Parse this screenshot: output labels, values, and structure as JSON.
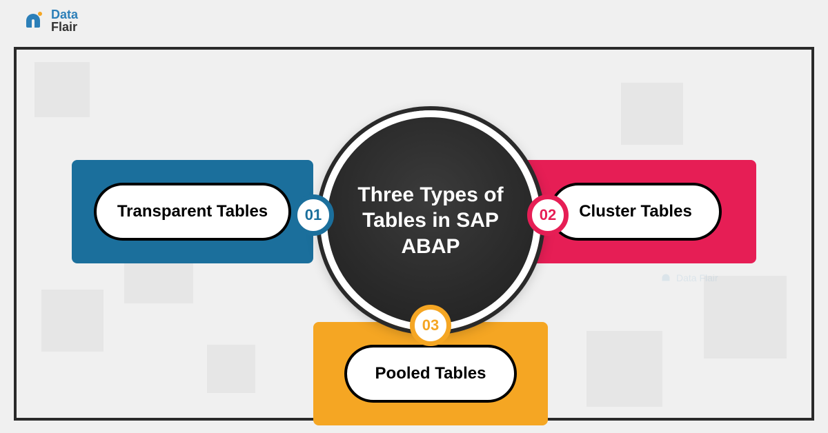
{
  "logo": {
    "line1": "Data",
    "line2": "Flair"
  },
  "title": "Three Types of Tables in SAP ABAP",
  "items": [
    {
      "num": "01",
      "label": "Transparent Tables",
      "color": "#1b6f9c"
    },
    {
      "num": "02",
      "label": "Cluster Tables",
      "color": "#e61e55"
    },
    {
      "num": "03",
      "label": "Pooled Tables",
      "color": "#f5a623"
    }
  ],
  "watermark": "Data Flair"
}
